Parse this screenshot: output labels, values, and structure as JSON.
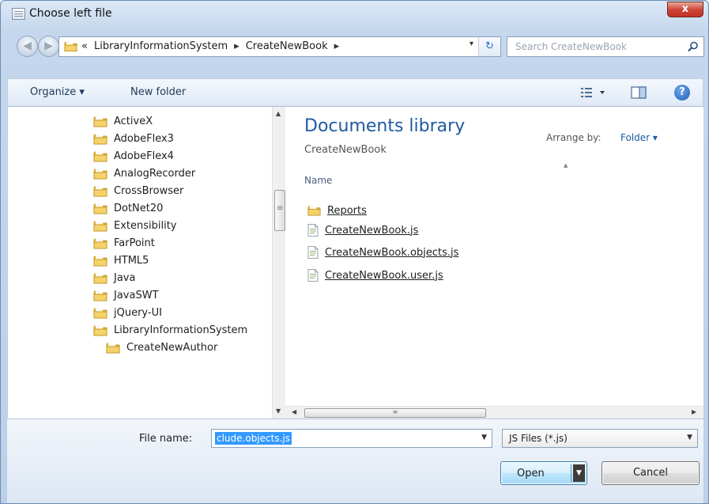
{
  "window": {
    "title": "Choose left file",
    "close_label": "x"
  },
  "address_bar": {
    "overflow": "«",
    "crumbs": [
      "LibraryInformationSystem",
      "CreateNewBook"
    ],
    "separator": "▸",
    "dropdown": "▾",
    "refresh": "↻"
  },
  "search": {
    "placeholder": "Search CreateNewBook"
  },
  "toolbar": {
    "organize": "Organize ▾",
    "new_folder": "New folder",
    "help": "?"
  },
  "nav_tree": {
    "items": [
      "ActiveX",
      "AdobeFlex3",
      "AdobeFlex4",
      "AnalogRecorder",
      "CrossBrowser",
      "DotNet20",
      "Extensibility",
      "FarPoint",
      "HTML5",
      "Java",
      "JavaSWT",
      "jQuery-UI",
      "LibraryInformationSystem"
    ],
    "sub_item": "CreateNewAuthor"
  },
  "content": {
    "library_title": "Documents library",
    "library_subtitle": "CreateNewBook",
    "arrange_by_label": "Arrange by:",
    "arrange_by_value": "Folder ▾",
    "column_name": "Name",
    "files": [
      {
        "name": "Reports",
        "icon": "folder-icon"
      },
      {
        "name": "CreateNewBook.js",
        "icon": "js-file-icon"
      },
      {
        "name": "CreateNewBook.objects.js",
        "icon": "js-file-icon"
      },
      {
        "name": "CreateNewBook.user.js",
        "icon": "js-file-icon"
      }
    ]
  },
  "file_name": {
    "label": "File name:",
    "value": "clude.objects.js"
  },
  "file_type": {
    "value": "JS Files (*.js)"
  },
  "buttons": {
    "open": "Open",
    "cancel": "Cancel"
  },
  "colors": {
    "accent": "#1e5aa0",
    "selection": "#3399ff",
    "close": "#c23125",
    "folder": "#e8b93f"
  }
}
